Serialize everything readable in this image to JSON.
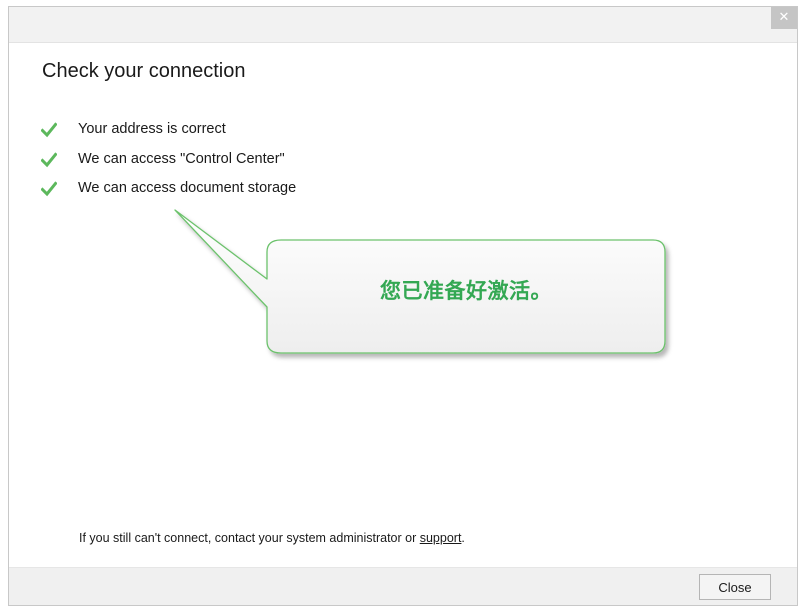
{
  "title_bar": {
    "close_glyph": "✕"
  },
  "dialog": {
    "heading": "Check your connection",
    "checks": [
      {
        "icon": "check-icon",
        "text": "Your address is correct"
      },
      {
        "icon": "check-icon",
        "text": "We can access \"Control Center\""
      },
      {
        "icon": "check-icon",
        "text": "We can access document storage"
      }
    ],
    "callout": {
      "text": "您已准备好激活。"
    },
    "footer": {
      "note_prefix": "If you still can't connect, contact your system administrator or ",
      "support_link": "support",
      "note_suffix": "."
    },
    "close_button": "Close"
  },
  "colors": {
    "check": "#5cb85c",
    "callout_border": "#6cc26c",
    "callout_text": "#34a853"
  }
}
